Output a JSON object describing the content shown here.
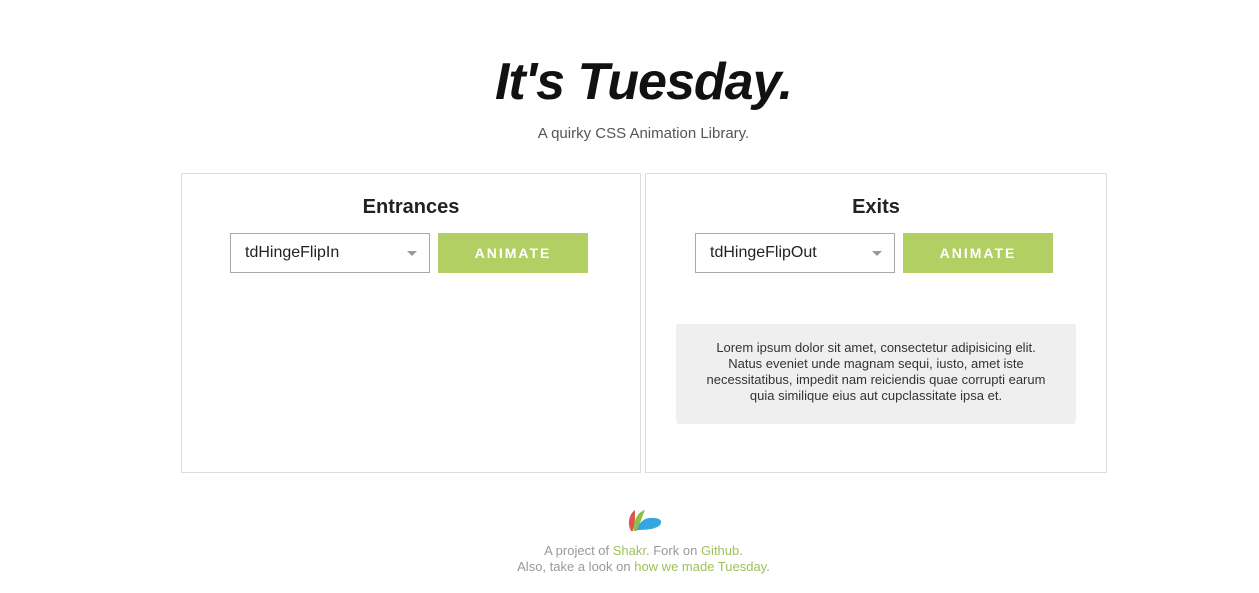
{
  "header": {
    "title": "It's Tuesday.",
    "subtitle": "A quirky CSS Animation Library."
  },
  "entrances": {
    "title": "Entrances",
    "selected": "tdHingeFlipIn",
    "button_label": "ANIMATE"
  },
  "exits": {
    "title": "Exits",
    "selected": "tdHingeFlipOut",
    "button_label": "ANIMATE",
    "sample_text": "Lorem ipsum dolor sit amet, consectetur adipisicing elit. Natus eveniet unde magnam sequi, iusto, amet iste necessitatibus, impedit nam reiciendis quae corrupti earum quia similique eius aut cupclassitate ipsa et."
  },
  "footer": {
    "line1_prefix": "A project of ",
    "shakr_link": "Shakr",
    "line1_middle": ". Fork on ",
    "github_link": "Github",
    "line1_suffix": ".",
    "line2_prefix": "Also, take a look on ",
    "how_link": "how we made Tuesday",
    "line2_suffix": "."
  },
  "colors": {
    "accent": "#b2cf64",
    "link": "#9fc25a",
    "logo_red": "#e0534f",
    "logo_green": "#8cc04b",
    "logo_blue": "#35a6de"
  },
  "icons": {
    "logo": "shakr-logo-icon",
    "select_caret": "chevron-down-icon"
  }
}
